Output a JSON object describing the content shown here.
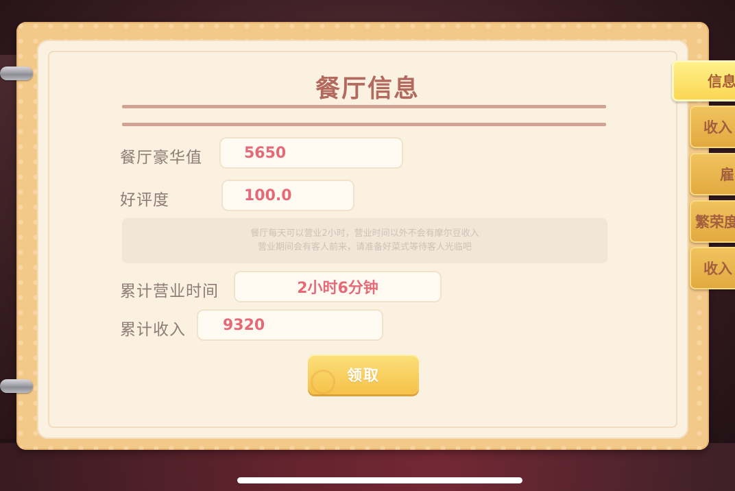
{
  "title": "餐厅信息",
  "stats": {
    "luxury": {
      "label": "餐厅豪华值",
      "value": "5650"
    },
    "rating": {
      "label": "好评度",
      "value": "100.0"
    },
    "time": {
      "label": "累计营业时间",
      "value": "2小时6分钟"
    },
    "income": {
      "label": "累计收入",
      "value": "9320"
    }
  },
  "notice": {
    "line1": "餐厅每天可以营业2小时，营业时间以外不会有摩尔豆收入",
    "line2": "营业期间会有客人前来，请准备好菜式等待客人光临吧"
  },
  "claim_label": "领取",
  "tabs": [
    {
      "label": "信息",
      "active": true
    },
    {
      "label": "收入"
    },
    {
      "label": "雇"
    },
    {
      "label": "繁荣度"
    },
    {
      "label": "收入"
    }
  ],
  "colors": {
    "book_border": "#f3c98a",
    "page_bg": "#fbf1e1",
    "title": "#b26a5e",
    "value_text": "#e56a78",
    "button": "#f6c24a"
  }
}
